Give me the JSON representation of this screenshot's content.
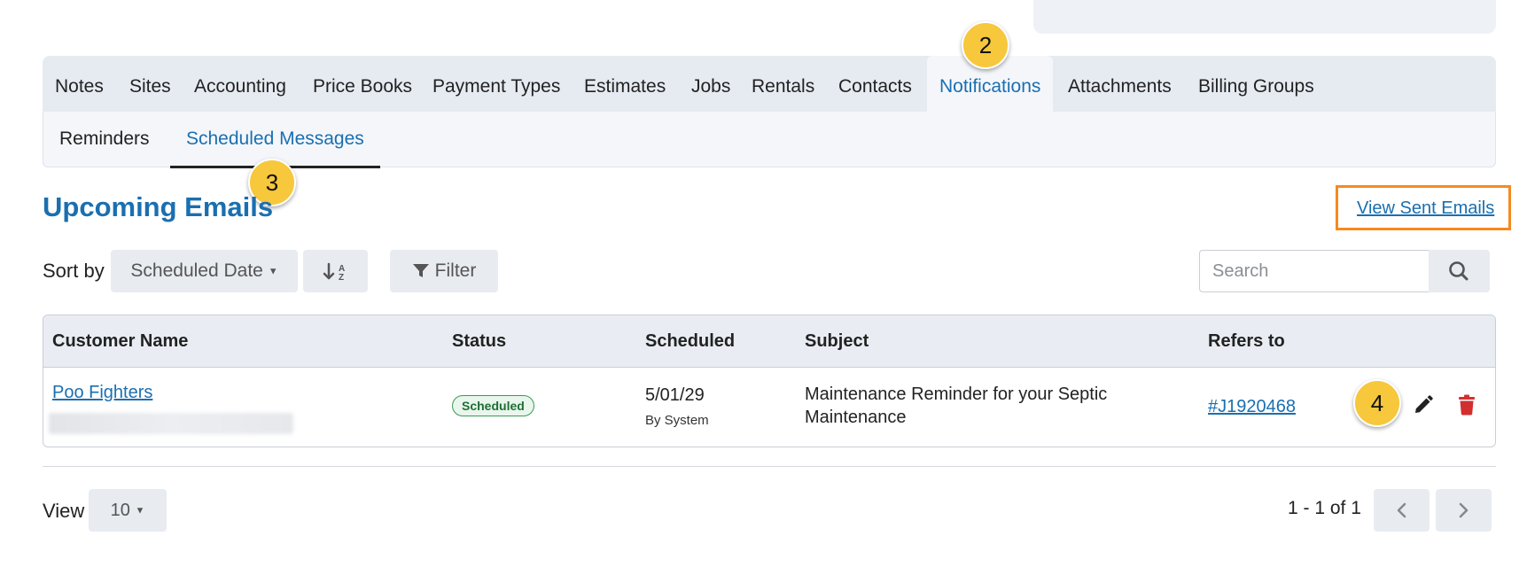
{
  "tabs": [
    "Notes",
    "Sites",
    "Accounting",
    "Price Books",
    "Payment Types",
    "Estimates",
    "Jobs",
    "Rentals",
    "Contacts",
    "Notifications",
    "Attachments",
    "Billing Groups"
  ],
  "subtabs": [
    "Reminders",
    "Scheduled Messages"
  ],
  "callouts": [
    "2",
    "3",
    "4"
  ],
  "heading": "Upcoming Emails",
  "view_sent_link": "View Sent Emails",
  "sort": {
    "label": "Sort by",
    "selected": "Scheduled Date"
  },
  "filter_label": "Filter",
  "search": {
    "placeholder": "Search"
  },
  "table": {
    "headers": [
      "Customer Name",
      "Status",
      "Scheduled",
      "Subject",
      "Refers to"
    ],
    "rows": [
      {
        "customer": "Poo Fighters",
        "status": "Scheduled",
        "scheduled_date": "5/01/29",
        "scheduled_by": "By System",
        "subject_line1": "Maintenance Reminder for your Septic",
        "subject_line2": "Maintenance",
        "refers_to": "#J1920468"
      }
    ]
  },
  "footer": {
    "view_label": "View",
    "page_size": "10",
    "pager_text": "1 - 1 of 1"
  },
  "colors": {
    "accent": "#1a6fb0",
    "callout": "#f7c73c",
    "highlight_border": "#f58a1f",
    "delete": "#d32f2f",
    "status_green": "#1f6e35"
  },
  "icons": [
    "sort-icon",
    "filter-icon",
    "search-icon",
    "pencil-icon",
    "trash-icon",
    "chevron-left-icon",
    "chevron-right-icon"
  ]
}
